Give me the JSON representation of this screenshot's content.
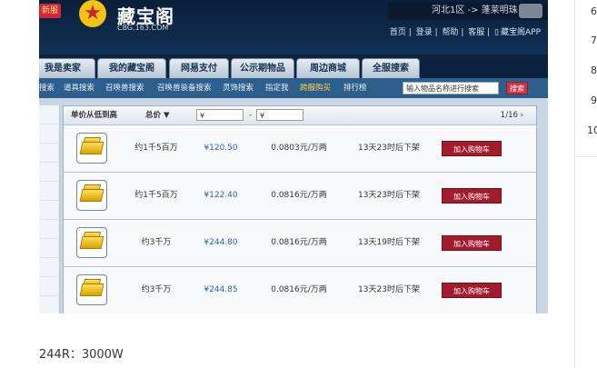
{
  "header": {
    "badge": "新服",
    "title": "藏宝阁",
    "subtitle": "CBG.163.COM",
    "server": "河北1区 -> 蓬莱明珠",
    "links": [
      "首页",
      "登录",
      "帮助",
      "客服",
      "藏宝阁APP"
    ]
  },
  "tabs": [
    "我是卖家",
    "我的藏宝阁",
    "网易支付",
    "公示期物品",
    "周边商城",
    "全服搜索"
  ],
  "subnav": {
    "items": [
      "搜索",
      "道具搜索",
      "召唤兽搜索",
      "召唤兽装备搜索",
      "灵饰搜索",
      "指定我",
      "跨服购买",
      "排行榜"
    ],
    "search_placeholder": "输入物品名称进行搜索",
    "search_button": "搜索"
  },
  "sortbar": {
    "unit_price_sort": "单价从低到高",
    "total_price": "总价",
    "price_from": "¥",
    "price_to": "¥",
    "dash": "-",
    "pager": "1/16"
  },
  "listings": [
    {
      "name": "约1千5百万",
      "price": "¥120.50",
      "unit": "0.0803元/万两",
      "time": "13天23时后下架",
      "cart": "加入购物车"
    },
    {
      "name": "约1千5百万",
      "price": "¥122.40",
      "unit": "0.0816元/万两",
      "time": "13天23时后下架",
      "cart": "加入购物车"
    },
    {
      "name": "约3千万",
      "price": "¥244.80",
      "unit": "0.0816元/万两",
      "time": "13天19时后下架",
      "cart": "加入购物车"
    },
    {
      "name": "约3千万",
      "price": "¥244.85",
      "unit": "0.0816元/万两",
      "time": "13天23时后下架",
      "cart": "加入购物车"
    }
  ],
  "caption": "244R：3000W",
  "line_numbers": [
    "6",
    "7",
    "8",
    "9",
    "10"
  ]
}
